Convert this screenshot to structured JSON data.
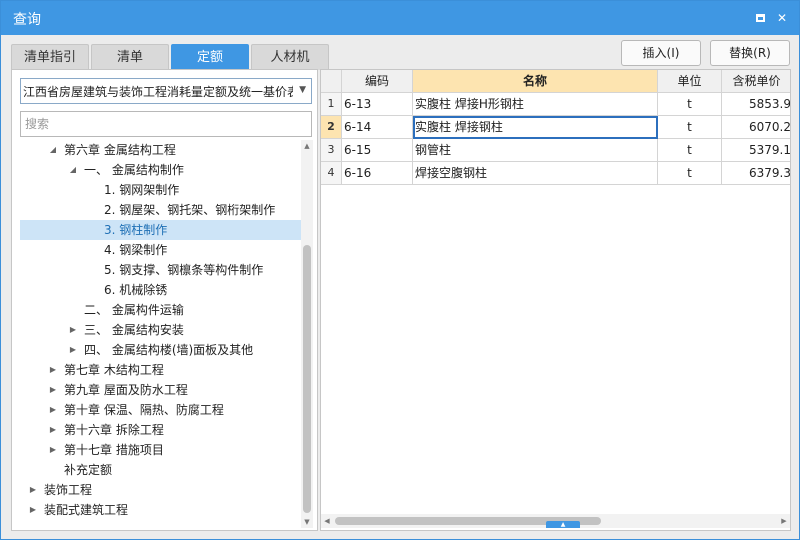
{
  "window": {
    "title": "查询"
  },
  "titlebar": {
    "maximize_glyph": "",
    "close_glyph": "✕"
  },
  "tabs": [
    {
      "label": "清单指引",
      "active": false
    },
    {
      "label": "清单",
      "active": false
    },
    {
      "label": "定额",
      "active": true
    },
    {
      "label": "人材机",
      "active": false
    }
  ],
  "actions": {
    "insert_label": "插入(I)",
    "replace_label": "替换(R)"
  },
  "left": {
    "quota_library": "江西省房屋建筑与装饰工程消耗量定额及统一基价表",
    "search_placeholder": "搜索",
    "tree": [
      {
        "label": "第六章 金属结构工程",
        "depth": 1,
        "toggle": "▲"
      },
      {
        "label": "一、 金属结构制作",
        "depth": 2,
        "toggle": "▲"
      },
      {
        "label": "1. 钢网架制作",
        "depth": 3,
        "toggle": ""
      },
      {
        "label": "2. 钢屋架、钢托架、钢桁架制作",
        "depth": 3,
        "toggle": ""
      },
      {
        "label": "3. 钢柱制作",
        "depth": 3,
        "toggle": "",
        "selected": true
      },
      {
        "label": "4. 钢梁制作",
        "depth": 3,
        "toggle": ""
      },
      {
        "label": "5. 钢支撑、钢檩条等构件制作",
        "depth": 3,
        "toggle": ""
      },
      {
        "label": "6. 机械除锈",
        "depth": 3,
        "toggle": ""
      },
      {
        "label": "二、 金属构件运输",
        "depth": 2,
        "toggle": ""
      },
      {
        "label": "三、 金属结构安装",
        "depth": 2,
        "toggle": "▶"
      },
      {
        "label": "四、 金属结构楼(墙)面板及其他",
        "depth": 2,
        "toggle": "▶"
      },
      {
        "label": "第七章 木结构工程",
        "depth": 1,
        "toggle": "▶"
      },
      {
        "label": "第九章 屋面及防水工程",
        "depth": 1,
        "toggle": "▶"
      },
      {
        "label": "第十章 保温、隔热、防腐工程",
        "depth": 1,
        "toggle": "▶"
      },
      {
        "label": "第十六章 拆除工程",
        "depth": 1,
        "toggle": "▶"
      },
      {
        "label": "第十七章 措施项目",
        "depth": 1,
        "toggle": "▶"
      },
      {
        "label": "补充定额",
        "depth": 1,
        "toggle": ""
      },
      {
        "label": "装饰工程",
        "depth": 0,
        "toggle": "▶"
      },
      {
        "label": "装配式建筑工程",
        "depth": 0,
        "toggle": "▶"
      }
    ]
  },
  "grid": {
    "headers": {
      "code": "编码",
      "name": "名称",
      "unit": "单位",
      "price": "含税单价"
    },
    "rows": [
      {
        "no": "1",
        "code": "6-13",
        "name": "实腹柱 焊接H形钢柱",
        "unit": "t",
        "price": "5853.9"
      },
      {
        "no": "2",
        "code": "6-14",
        "name": "实腹柱 焊接钢柱",
        "unit": "t",
        "price": "6070.2"
      },
      {
        "no": "3",
        "code": "6-15",
        "name": "钢管柱",
        "unit": "t",
        "price": "5379.1"
      },
      {
        "no": "4",
        "code": "6-16",
        "name": "焊接空腹钢柱",
        "unit": "t",
        "price": "6379.3"
      }
    ]
  },
  "colors": {
    "accent": "#3f97e3",
    "selection": "#cde4f7",
    "header_highlight": "#fde4b0"
  }
}
